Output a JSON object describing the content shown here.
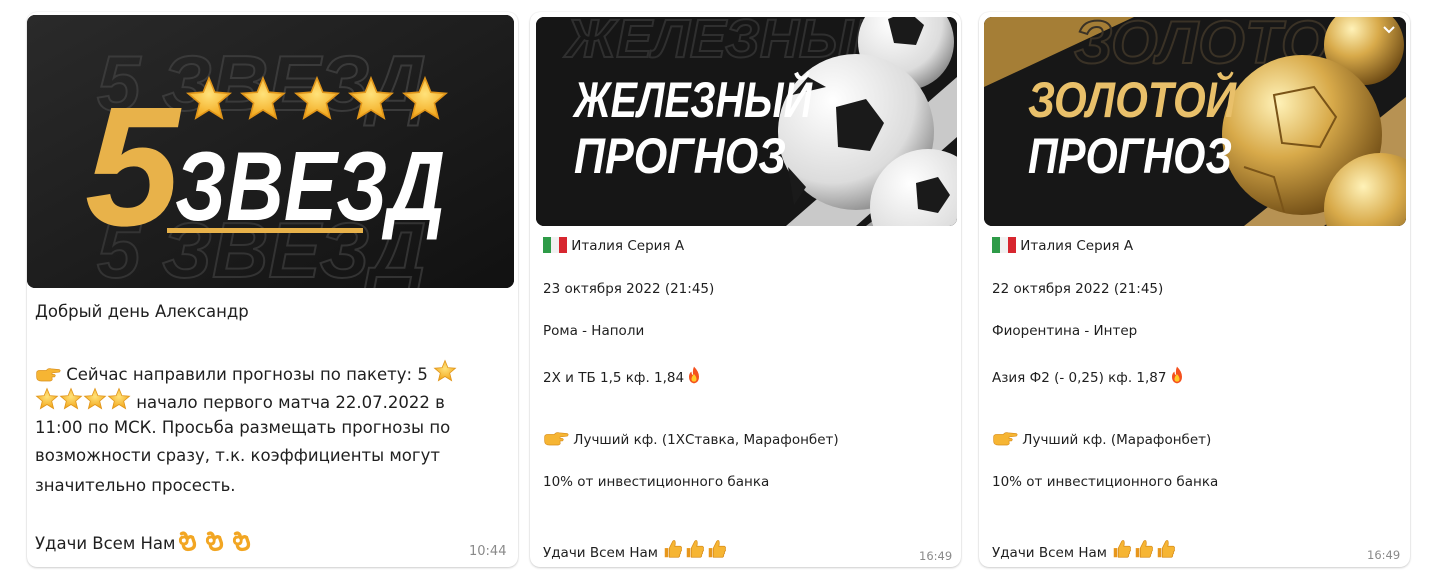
{
  "cards": [
    {
      "banner": {
        "big_digit": "5",
        "title": "ЗВЕЗД",
        "bg_text_top": "5 ЗВЕЗД",
        "bg_text_bottom": "5 ЗВЕЗД",
        "stars": 5
      },
      "greeting": "Добрый день Александр",
      "line1": "Сейчас направили прогнозы по пакету: 5",
      "line2": "начало первого матча 22.07.2022 в",
      "line3": "11:00 по МСК. Просьба размещать прогнозы по",
      "line4": "возможности сразу, т.к. коэффициенты могут",
      "line5": "значительно просесть.",
      "closing": "Удачи Всем Нам",
      "time": "10:44"
    },
    {
      "banner": {
        "word1": "ЖЕЛЕЗНЫЙ",
        "word2": "ПРОГНОЗ",
        "bg_text": "ЖЕЛЕЗНЫЙ"
      },
      "league": "Италия Серия А",
      "date": "23 октября 2022 (21:45)",
      "match": "Рома - Наполи",
      "bet": "2Х и ТБ 1,5 кф. 1,84",
      "best": "Лучший кф. (1ХСтавка, Марафонбет)",
      "bank": "10% от инвестиционного банка",
      "closing": "Удачи Всем Нам",
      "time": "16:49"
    },
    {
      "banner": {
        "word1": "ЗОЛОТОЙ",
        "word2": "ПРОГНОЗ",
        "bg_text": "ЗОЛОТОЙ"
      },
      "league": "Италия Серия А",
      "date": "22 октября 2022 (21:45)",
      "match": "Фиорентина - Интер",
      "bet": "Азия Ф2 (- 0,25) кф. 1,87",
      "best": "Лучший кф. (Марафонбет)",
      "bank": "10% от инвестиционного банка",
      "closing": "Удачи Всем Нам",
      "time": "16:49"
    }
  ],
  "icons": {
    "star": "star-emoji",
    "point": "backhand-pointing-right-emoji",
    "ok": "ok-hand-emoji",
    "fire": "fire-emoji",
    "thumb": "thumbs-up-emoji",
    "flag": "italy-flag"
  },
  "colors": {
    "gold": "#e8b24a",
    "banner_bg": "#1a1a1a",
    "time": "#8a8a8a"
  }
}
